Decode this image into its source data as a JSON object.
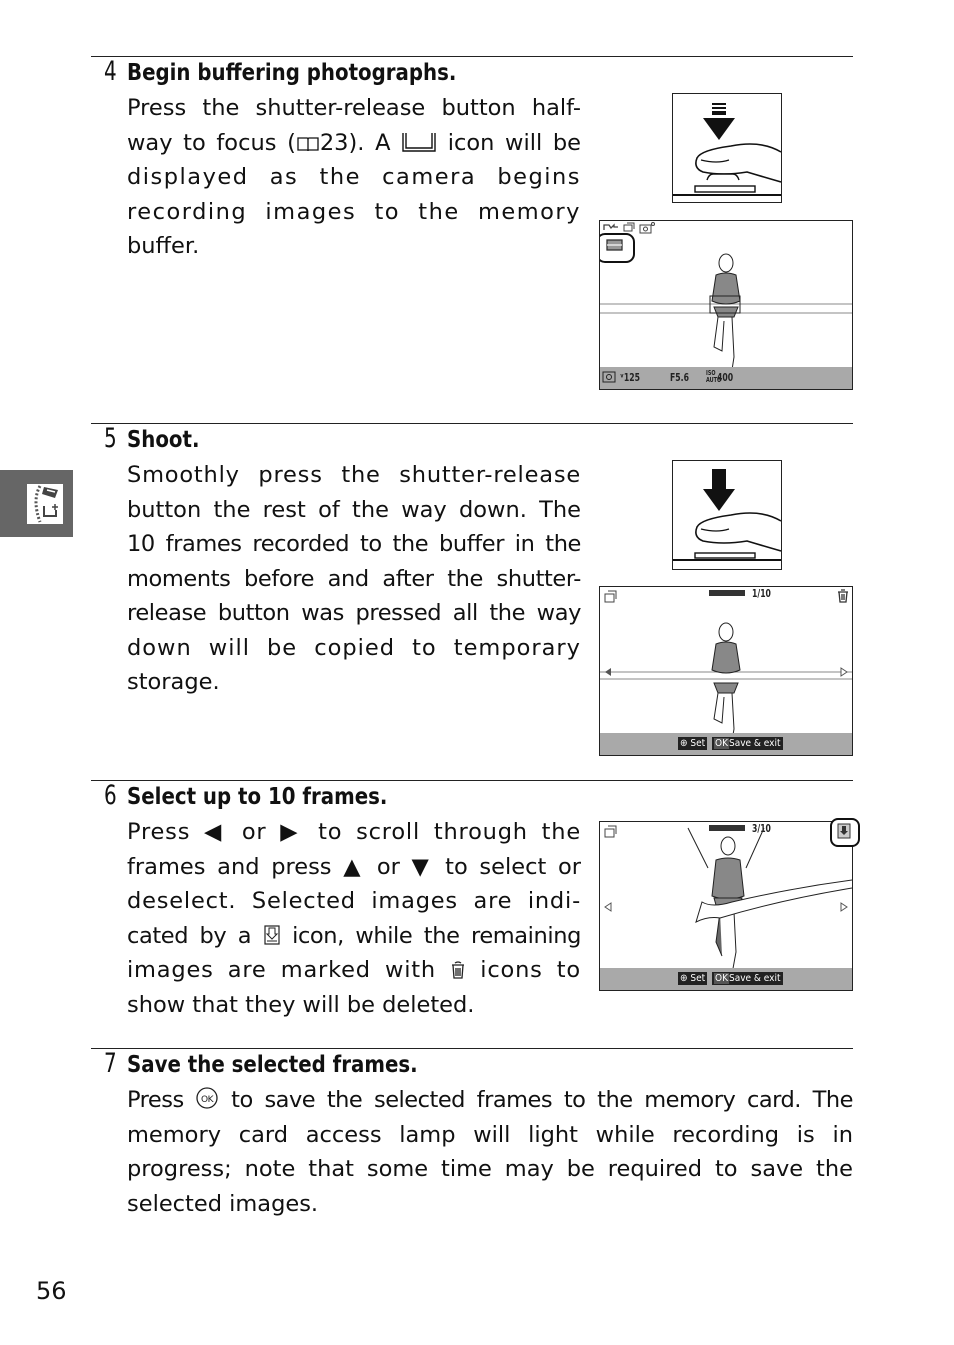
{
  "page_number": "56",
  "section_tab": {
    "icon": "retouch-menu-icon"
  },
  "steps": [
    {
      "number": "4",
      "title": "Begin buffering photographs.",
      "lines": [
        "Press the shutter-release button half-",
        "way to focus (",
        "23). A ",
        " icon will be",
        "displayed as the camera begins",
        "recording images to the memory",
        "buffer."
      ],
      "page_ref_icon": "book-icon",
      "inline_icon": "buffer-icon",
      "illustration": {
        "name": "shutter-half-press",
        "icon": "half-press-arrow-icon"
      },
      "screen": {
        "top_icons": [
          "mode-icon",
          "best-moment-icon",
          "camera-icon"
        ],
        "highlighted_icon": "buffer-icon",
        "bottom_readout": {
          "metering": "metering-icon",
          "shutter": "125",
          "aperture": "F5.6",
          "iso_label": "ISO AUTO",
          "iso": "400"
        }
      }
    },
    {
      "number": "5",
      "title": "Shoot.",
      "lines": [
        "Smoothly press the shutter-release",
        "button the rest of the way down. The",
        "10 frames recorded to the buffer in the",
        "moments before and after the shutter-",
        "release button was pressed all the way",
        "down will be copied to temporary",
        "storage."
      ],
      "illustration": {
        "name": "shutter-full-press",
        "icon": "full-press-arrow-icon"
      },
      "screen": {
        "frame_counter": "1/10",
        "frame_position": 0.1,
        "corner_icon": "trash-icon",
        "hint_set": "Set",
        "hint_ok": "OK",
        "hint_save": "Save & exit"
      }
    },
    {
      "number": "6",
      "title": "Select up to 10 frames.",
      "lines": [
        [
          "Press ",
          "◀",
          " or ",
          "▶",
          " to scroll through the"
        ],
        [
          "frames and press ",
          "▲",
          " or ",
          "▼",
          " to select or"
        ],
        "deselect. Selected images are indi-",
        [
          "cated by a ",
          "save-icon",
          " icon, while the remaining"
        ],
        [
          "images are marked with ",
          "trash-icon",
          " icons to"
        ],
        "show that they will be deleted."
      ],
      "screen": {
        "frame_counter": "3/10",
        "frame_position": 0.3,
        "corner_icon": "save-icon",
        "hint_set": "Set",
        "hint_ok": "OK",
        "hint_save": "Save & exit"
      }
    },
    {
      "number": "7",
      "title": "Save the selected frames.",
      "lines": [
        [
          "Press ",
          "ok-button-icon",
          " to save the selected frames to the memory card. The"
        ],
        "memory card access lamp will light while recording is in",
        "progress; note that some time may be required to save the",
        "selected images."
      ]
    }
  ]
}
